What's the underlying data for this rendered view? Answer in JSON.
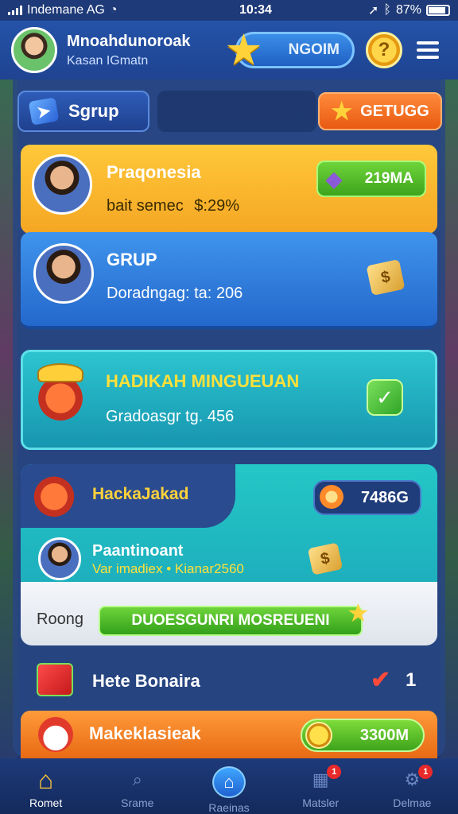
{
  "status_bar": {
    "carrier": "Indemane AG",
    "time": "10:34",
    "battery": "87%"
  },
  "header": {
    "user_name": "Mnoahdunoroak",
    "user_subtitle": "Kasan IGmatn",
    "level_label": "NGOIM",
    "coin_symbol": "?"
  },
  "tabs": {
    "group_tab": "Sgrup",
    "action_button": "GETUGG"
  },
  "cards": {
    "profile": {
      "title": "Praqonesia",
      "line": "bait semec",
      "line_value": "$:29%",
      "pill_value": "219MA"
    },
    "group": {
      "title": "GRUP",
      "line": "Doradngag: ta: 206"
    },
    "weekly": {
      "title": "HADIKAH MINGUEUAN",
      "line": "Gradoasgr tg. 456"
    },
    "group_box": {
      "title": "HackaJakad",
      "pill_value": "7486G",
      "item_title": "Paantinoant",
      "item_line": "Var imadiex • Kianar2560"
    },
    "reward": {
      "label": "Roong",
      "bar_text": "DUOESGUNRI MOSREUENI"
    },
    "bonus_row": {
      "title": "Hete Bonaira",
      "count": "1"
    },
    "market": {
      "title": "Makeklasieak",
      "pill_value": "3300M"
    }
  },
  "bottom_nav": [
    {
      "label": "Romet",
      "icon": "home-icon",
      "badge": ""
    },
    {
      "label": "Srame",
      "icon": "search-icon",
      "badge": ""
    },
    {
      "label": "Raeinas",
      "icon": "home-center-icon",
      "badge": ""
    },
    {
      "label": "Matsler",
      "icon": "chart-icon",
      "badge": "1"
    },
    {
      "label": "Delmae",
      "icon": "gear-icon",
      "badge": "1"
    }
  ],
  "colors": {
    "accent_yellow": "#ffc83a",
    "accent_blue": "#2468cc",
    "accent_teal": "#1796b0",
    "accent_green": "#3ea41c",
    "accent_orange": "#e86a14"
  }
}
